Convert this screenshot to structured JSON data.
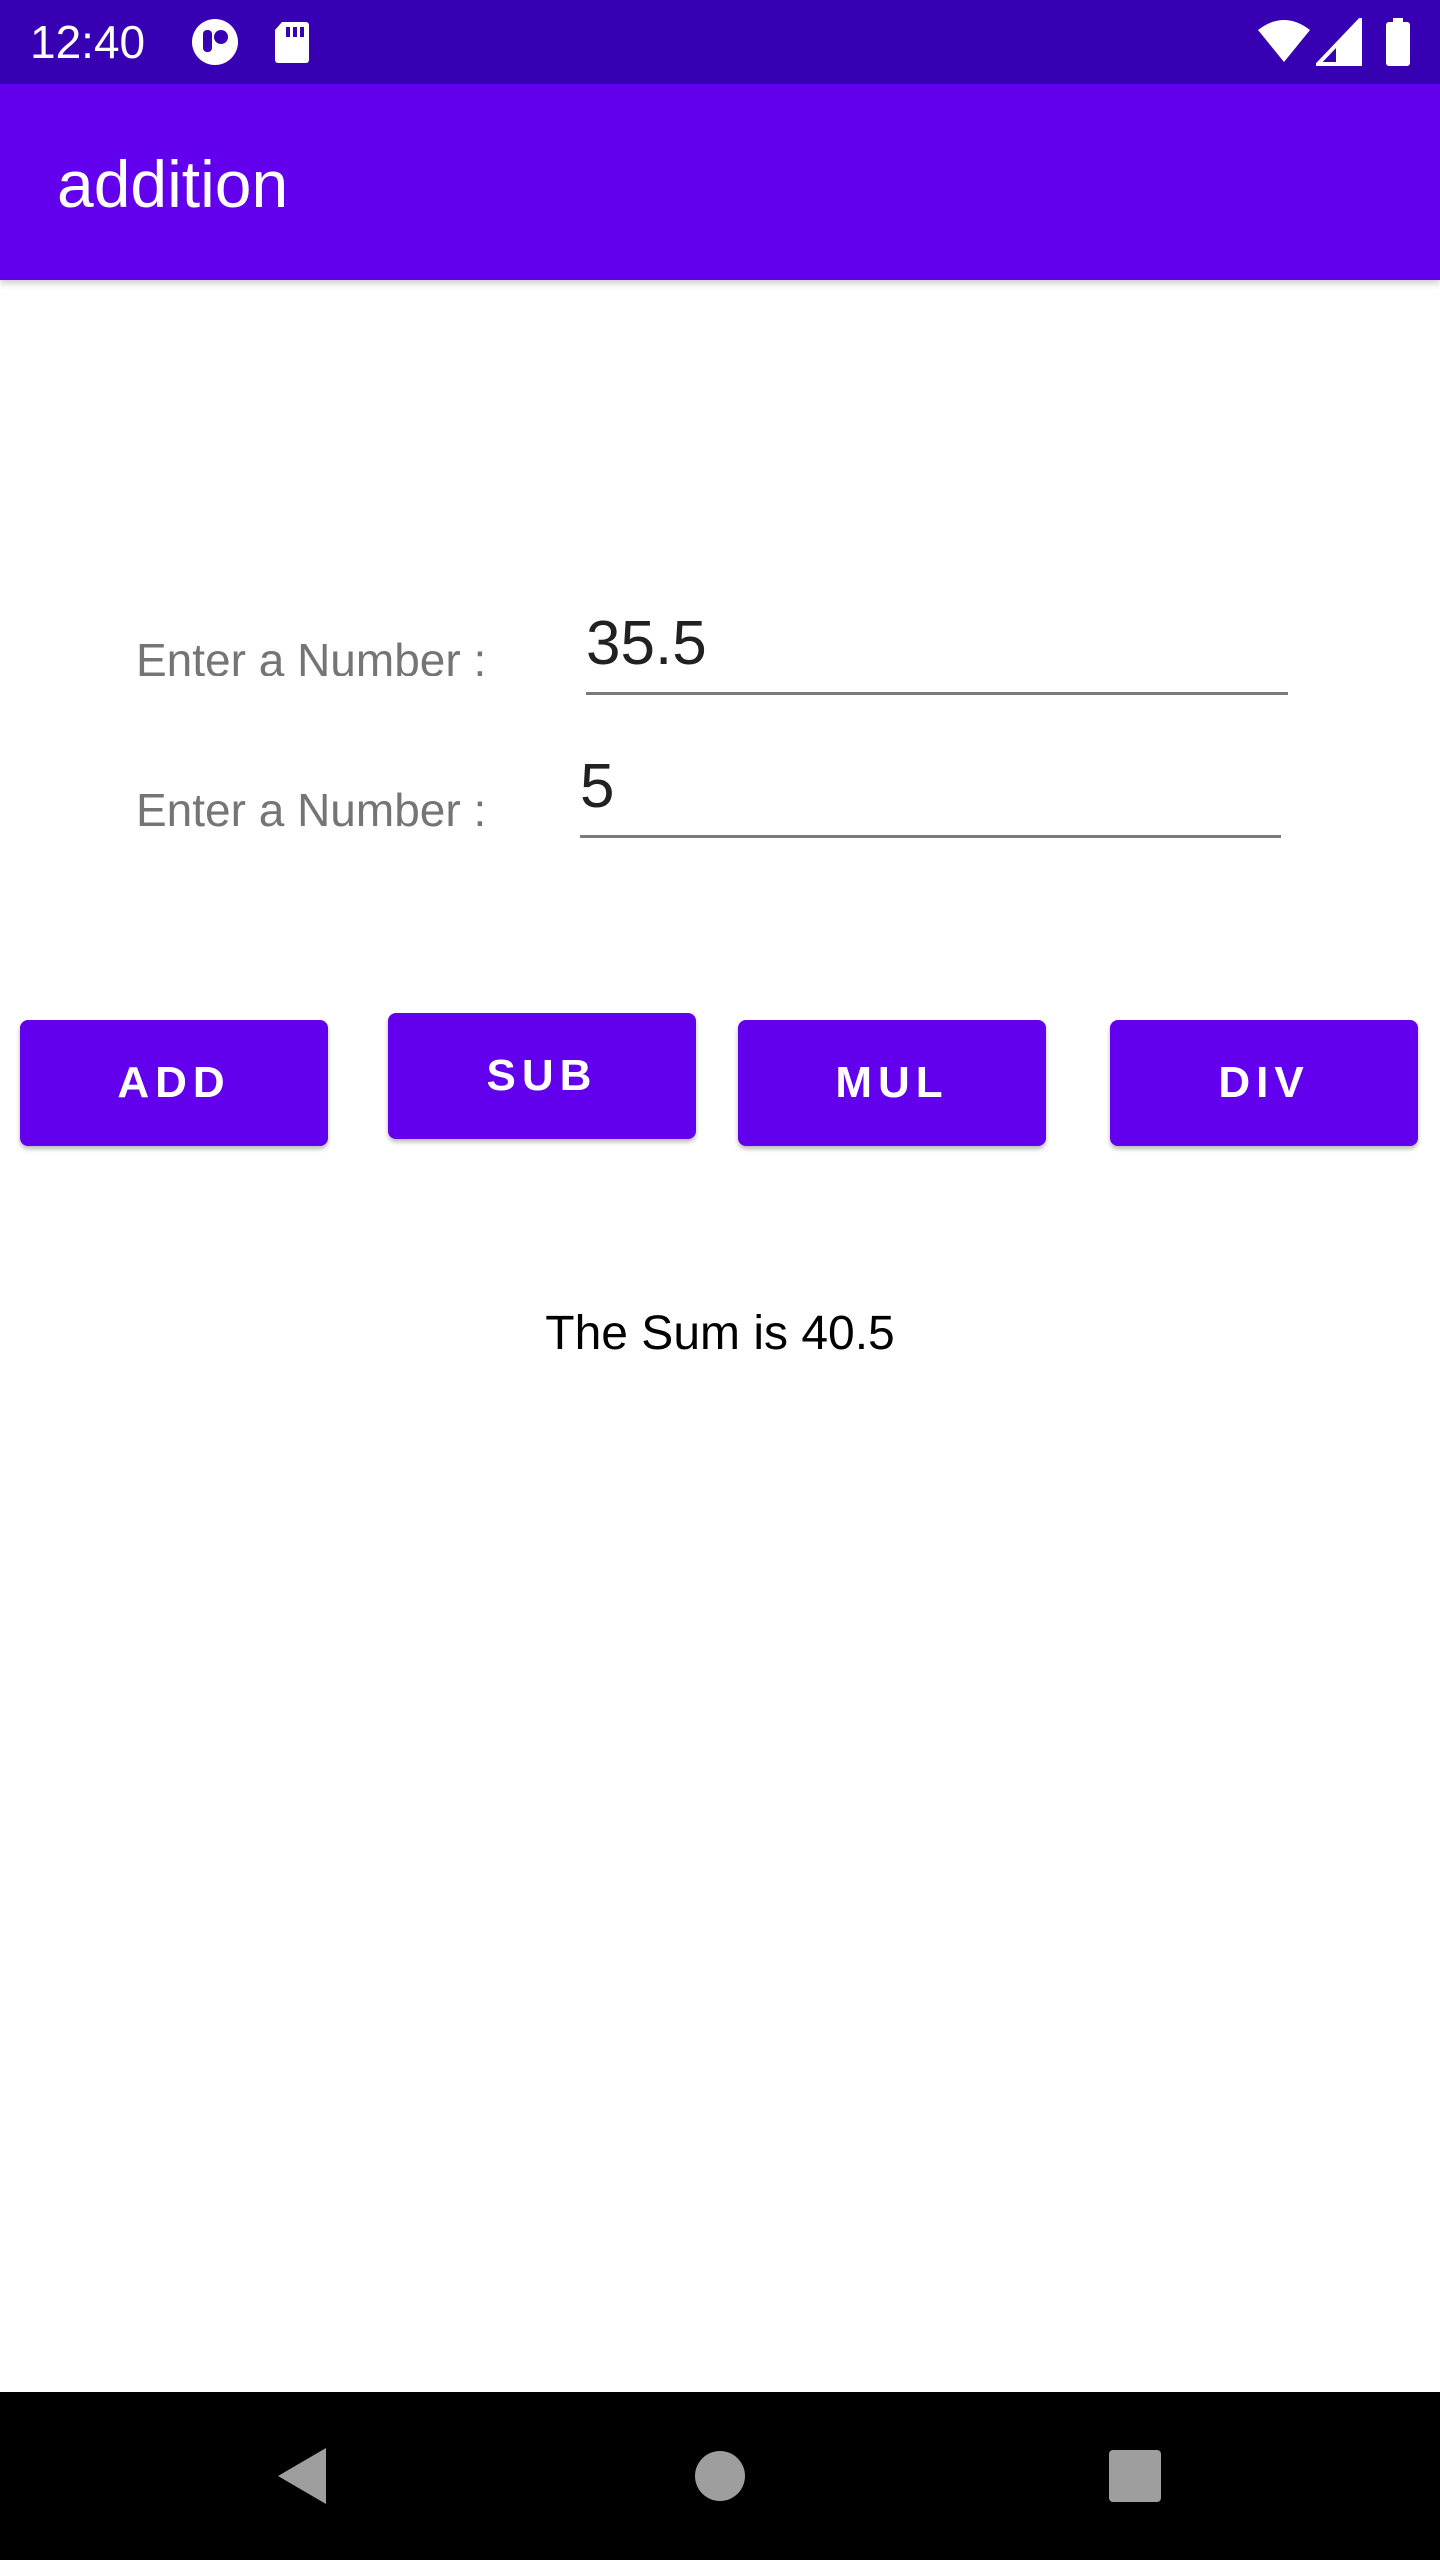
{
  "status_bar": {
    "time": "12:40",
    "left_icons": [
      "notification-app-icon",
      "sd-card-icon"
    ],
    "right_icons": [
      "wifi-icon",
      "signal-icon",
      "battery-icon"
    ],
    "color": "#3700b3"
  },
  "app_bar": {
    "title": "addition",
    "color": "#6200ee"
  },
  "form": {
    "first": {
      "label": "Enter a Number :",
      "value": "35.5"
    },
    "second": {
      "label": "Enter a Number :",
      "value": "5"
    }
  },
  "buttons": {
    "add": "ADD",
    "sub": "SUB",
    "mul": "MUL",
    "div": "DIV",
    "color": "#6200ee"
  },
  "result": {
    "text": "The Sum is 40.5"
  },
  "nav_bar": {
    "icons": [
      "back-icon",
      "home-icon",
      "recents-icon"
    ]
  }
}
